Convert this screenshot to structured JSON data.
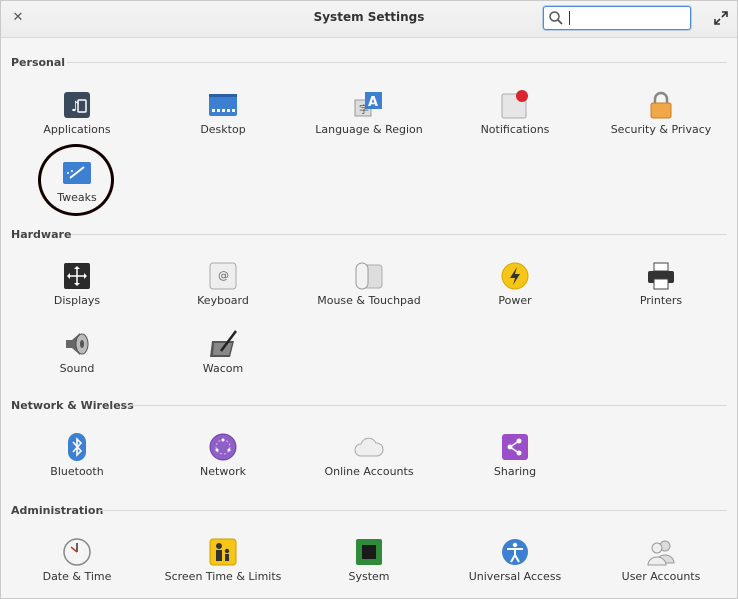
{
  "window": {
    "title": "System Settings"
  },
  "search": {
    "placeholder": "",
    "value": ""
  },
  "sections": {
    "personal": {
      "title": "Personal",
      "items": [
        "Applications",
        "Desktop",
        "Language & Region",
        "Notifications",
        "Security & Privacy",
        "Tweaks"
      ]
    },
    "hardware": {
      "title": "Hardware",
      "items": [
        "Displays",
        "Keyboard",
        "Mouse & Touchpad",
        "Power",
        "Printers",
        "Sound",
        "Wacom"
      ]
    },
    "network": {
      "title": "Network & Wireless",
      "items": [
        "Bluetooth",
        "Network",
        "Online Accounts",
        "Sharing"
      ]
    },
    "administration": {
      "title": "Administration",
      "items": [
        "Date & Time",
        "Screen Time & Limits",
        "System",
        "Universal Access",
        "User Accounts"
      ]
    }
  },
  "colors": {
    "accent": "#4d8bd6",
    "annotation": "#120000"
  }
}
